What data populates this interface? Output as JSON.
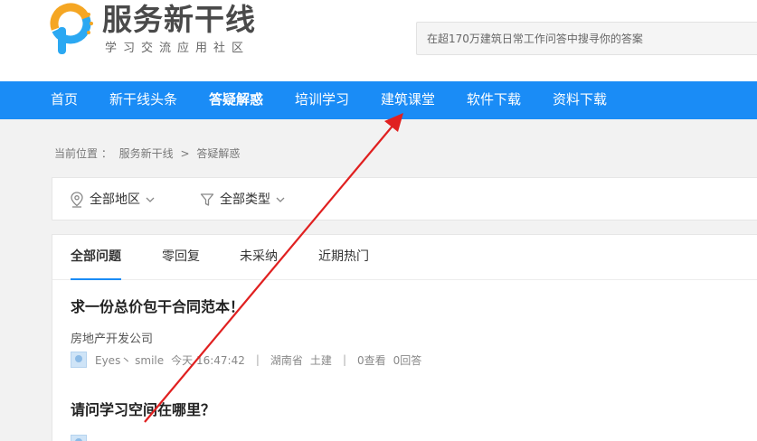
{
  "header": {
    "logo_text": "服务新干线",
    "logo_subtitle": "学习交流应用社区",
    "search_placeholder": "在超170万建筑日常工作问答中搜寻你的答案"
  },
  "nav": {
    "items": [
      {
        "label": "首页"
      },
      {
        "label": "新干线头条"
      },
      {
        "label": "答疑解惑",
        "active": true
      },
      {
        "label": "培训学习"
      },
      {
        "label": "建筑课堂"
      },
      {
        "label": "软件下载"
      },
      {
        "label": "资料下载"
      }
    ],
    "color": "#1a8cf6"
  },
  "breadcrumb": {
    "prefix": "当前位置 ：",
    "home": "服务新干线",
    "sep": ">",
    "current": "答疑解惑"
  },
  "filters": {
    "region": "全部地区",
    "type": "全部类型"
  },
  "tabs": [
    {
      "label": "全部问题",
      "active": true
    },
    {
      "label": "零回复"
    },
    {
      "label": "未采纳"
    },
    {
      "label": "近期热门"
    }
  ],
  "questions": [
    {
      "title": "求一份总价包干合同范本！",
      "org": "房地产开发公司",
      "user": "Eyes丶 smile",
      "time": "今天 16:47:42",
      "region": "湖南省",
      "category": "土建",
      "views": "0查看",
      "answers": "0回答"
    },
    {
      "title": "请问学习空间在哪里？"
    }
  ],
  "annotation": {
    "arrow_color": "#e02020"
  }
}
